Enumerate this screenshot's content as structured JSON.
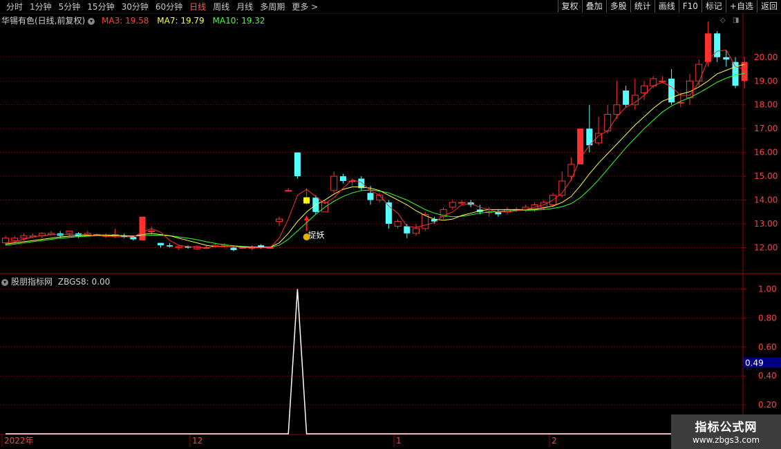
{
  "toolbar": {
    "periods": [
      "分时",
      "1分钟",
      "5分钟",
      "15分钟",
      "30分钟",
      "60分钟",
      "日线",
      "周线",
      "月线",
      "多周期",
      "更多 >"
    ],
    "active_period": "日线",
    "buttons": [
      "复权",
      "叠加",
      "多股",
      "统计",
      "画线",
      "F10",
      "标记",
      "+自选",
      "返回"
    ]
  },
  "main_chart": {
    "stock_name": "华锡有色(日线,前复权)",
    "ma3": "MA3: 19.58",
    "ma7": "MA7: 19.79",
    "ma10": "MA10: 19.32",
    "signal_label": "捉妖"
  },
  "indicator": {
    "name": "股朋指标网",
    "value_text": "ZBGS8: 0.00",
    "current_marker": "0.49"
  },
  "time_axis": [
    "2022年",
    "12",
    "1",
    "2"
  ],
  "watermark": {
    "line1": "指标公式网",
    "line2": "www.zbgs3.com"
  },
  "colors": {
    "up": "#ff3030",
    "down": "#54ffff",
    "ma3": "#ff3030",
    "ma7": "#ffff50",
    "ma10": "#30ff30",
    "grid": "#800000"
  },
  "chart_data": [
    {
      "type": "candlestick",
      "yticks": [
        12.0,
        13.0,
        14.0,
        15.0,
        16.0,
        17.0,
        18.0,
        19.0,
        20.0
      ],
      "ylim": [
        11.0,
        21.3
      ],
      "candles": [
        [
          12.2,
          12.4,
          12.5,
          12.1
        ],
        [
          12.3,
          12.4,
          12.5,
          12.2
        ],
        [
          12.4,
          12.5,
          12.6,
          12.3
        ],
        [
          12.45,
          12.5,
          12.6,
          12.4
        ],
        [
          12.5,
          12.6,
          12.65,
          12.4
        ],
        [
          12.55,
          12.6,
          12.7,
          12.5
        ],
        [
          12.6,
          12.5,
          12.7,
          12.4
        ],
        [
          12.6,
          12.7,
          12.7,
          12.5
        ],
        [
          12.6,
          12.5,
          12.65,
          12.4
        ],
        [
          12.5,
          12.6,
          12.7,
          12.5
        ],
        [
          12.55,
          12.55,
          12.6,
          12.5
        ],
        [
          12.5,
          12.5,
          12.6,
          12.4
        ],
        [
          12.5,
          12.55,
          12.8,
          12.4
        ],
        [
          12.5,
          12.45,
          12.6,
          12.4
        ],
        [
          12.45,
          12.35,
          12.5,
          12.3
        ],
        [
          12.3,
          13.3,
          13.3,
          12.3
        ],
        [
          12.7,
          12.7,
          12.9,
          12.5
        ],
        [
          12.2,
          12.1,
          12.2,
          12.0
        ],
        [
          12.1,
          12.05,
          12.2,
          12.0
        ],
        [
          12.0,
          12.05,
          12.1,
          11.9
        ],
        [
          12.05,
          12.0,
          12.1,
          11.95
        ],
        [
          11.95,
          12.05,
          12.1,
          11.9
        ],
        [
          12.0,
          12.0,
          12.1,
          11.95
        ],
        [
          12.05,
          12.1,
          12.2,
          12.0
        ],
        [
          12.05,
          12.1,
          12.2,
          12.0
        ],
        [
          12.0,
          11.9,
          12.1,
          11.85
        ],
        [
          12.0,
          12.0,
          12.05,
          11.95
        ],
        [
          12.0,
          12.0,
          12.1,
          11.9
        ],
        [
          12.1,
          12.0,
          12.15,
          11.95
        ],
        [
          12.0,
          12.0,
          12.05,
          11.95
        ],
        [
          13.1,
          13.2,
          13.3,
          12.9
        ],
        [
          14.4,
          14.4,
          14.5,
          14.4
        ],
        [
          16.0,
          15.0,
          16.0,
          14.9
        ],
        [
          14.0,
          14.0,
          14.5,
          13.8
        ],
        [
          14.1,
          13.5,
          14.2,
          13.4
        ],
        [
          13.5,
          13.9,
          14.0,
          13.5
        ],
        [
          14.4,
          15.0,
          15.2,
          14.3
        ],
        [
          15.0,
          14.8,
          15.1,
          14.7
        ],
        [
          14.8,
          14.8,
          14.9,
          14.6
        ],
        [
          14.9,
          14.5,
          15.0,
          14.4
        ],
        [
          14.3,
          14.0,
          14.6,
          13.8
        ],
        [
          14.0,
          14.2,
          14.3,
          13.9
        ],
        [
          13.9,
          13.0,
          14.0,
          12.8
        ],
        [
          12.9,
          13.1,
          13.2,
          12.8
        ],
        [
          12.9,
          12.6,
          13.0,
          12.4
        ],
        [
          12.6,
          12.8,
          13.0,
          12.5
        ],
        [
          12.8,
          13.4,
          13.5,
          12.7
        ],
        [
          13.2,
          13.1,
          13.3,
          13.0
        ],
        [
          13.3,
          13.6,
          13.7,
          13.2
        ],
        [
          13.7,
          13.9,
          14.0,
          13.6
        ],
        [
          13.9,
          13.9,
          14.0,
          13.8
        ],
        [
          13.9,
          13.8,
          14.0,
          13.7
        ],
        [
          13.6,
          13.5,
          13.8,
          13.4
        ],
        [
          13.5,
          13.5,
          13.7,
          13.3
        ],
        [
          13.5,
          13.4,
          13.6,
          13.3
        ],
        [
          13.5,
          13.6,
          13.7,
          13.4
        ],
        [
          13.6,
          13.6,
          13.7,
          13.5
        ],
        [
          13.6,
          13.7,
          13.8,
          13.5
        ],
        [
          13.6,
          13.8,
          13.9,
          13.5
        ],
        [
          13.7,
          13.9,
          14.0,
          13.6
        ],
        [
          13.8,
          14.2,
          14.3,
          13.7
        ],
        [
          14.2,
          14.8,
          15.2,
          14.1
        ],
        [
          15.0,
          15.5,
          15.8,
          14.8
        ],
        [
          15.5,
          17.0,
          17.0,
          15.5
        ],
        [
          17.0,
          16.3,
          18.0,
          16.0
        ],
        [
          16.4,
          16.8,
          17.5,
          16.3
        ],
        [
          16.9,
          17.6,
          18.0,
          16.8
        ],
        [
          17.6,
          18.0,
          19.0,
          17.4
        ],
        [
          18.6,
          18.0,
          18.8,
          17.9
        ],
        [
          18.0,
          18.4,
          19.1,
          17.8
        ],
        [
          18.5,
          18.8,
          19.0,
          18.2
        ],
        [
          18.8,
          19.1,
          19.2,
          18.7
        ],
        [
          19.0,
          19.0,
          19.2,
          18.9
        ],
        [
          19.1,
          18.1,
          19.5,
          18.0
        ],
        [
          18.1,
          18.1,
          18.5,
          17.9
        ],
        [
          18.3,
          19.0,
          19.3,
          18.0
        ],
        [
          19.0,
          19.7,
          19.9,
          18.8
        ],
        [
          19.8,
          21.0,
          21.5,
          19.6
        ],
        [
          21.0,
          20.0,
          21.1,
          19.8
        ],
        [
          20.0,
          19.9,
          20.3,
          19.6
        ],
        [
          19.8,
          18.8,
          20.0,
          18.7
        ],
        [
          19.0,
          19.8,
          20.0,
          18.7
        ]
      ],
      "ma3": [
        12.2,
        12.25,
        12.35,
        12.45,
        12.5,
        12.55,
        12.55,
        12.55,
        12.55,
        12.55,
        12.5,
        12.5,
        12.45,
        12.45,
        12.45,
        12.65,
        12.8,
        12.65,
        12.3,
        12.1,
        12.05,
        12.0,
        12.0,
        12.05,
        12.05,
        12.05,
        12.0,
        12.0,
        12.0,
        12.0,
        12.4,
        13.2,
        14.2,
        14.45,
        14.15,
        13.85,
        14.1,
        14.5,
        14.85,
        14.75,
        14.4,
        14.2,
        13.75,
        13.45,
        12.9,
        12.85,
        12.95,
        13.05,
        13.35,
        13.5,
        13.8,
        13.85,
        13.7,
        13.6,
        13.5,
        13.5,
        13.55,
        13.6,
        13.7,
        13.8,
        14.0,
        14.3,
        14.85,
        15.75,
        16.3,
        16.7,
        16.9,
        17.5,
        17.9,
        18.1,
        18.4,
        18.8,
        18.95,
        18.75,
        18.4,
        18.4,
        18.95,
        19.9,
        20.25,
        20.3,
        19.6,
        19.5
      ],
      "ma7": [
        12.15,
        12.2,
        12.25,
        12.3,
        12.35,
        12.4,
        12.45,
        12.48,
        12.5,
        12.52,
        12.53,
        12.53,
        12.52,
        12.5,
        12.48,
        12.55,
        12.6,
        12.55,
        12.5,
        12.4,
        12.3,
        12.2,
        12.1,
        12.05,
        12.05,
        12.05,
        12.03,
        12.02,
        12.02,
        12.02,
        12.2,
        12.6,
        13.1,
        13.5,
        13.8,
        14.0,
        14.25,
        14.45,
        14.55,
        14.55,
        14.5,
        14.4,
        14.2,
        14.0,
        13.8,
        13.55,
        13.35,
        13.2,
        13.15,
        13.2,
        13.35,
        13.45,
        13.55,
        13.6,
        13.6,
        13.6,
        13.6,
        13.6,
        13.62,
        13.67,
        13.75,
        13.9,
        14.15,
        14.6,
        15.1,
        15.55,
        15.95,
        16.35,
        16.75,
        17.15,
        17.5,
        17.85,
        18.15,
        18.3,
        18.45,
        18.55,
        18.75,
        19.0,
        19.3,
        19.45,
        19.6,
        19.7
      ],
      "ma10": [
        12.1,
        12.15,
        12.2,
        12.25,
        12.3,
        12.35,
        12.4,
        12.43,
        12.46,
        12.48,
        12.5,
        12.5,
        12.5,
        12.5,
        12.49,
        12.5,
        12.52,
        12.52,
        12.5,
        12.45,
        12.4,
        12.33,
        12.25,
        12.18,
        12.12,
        12.08,
        12.05,
        12.03,
        12.02,
        12.02,
        12.1,
        12.35,
        12.7,
        13.05,
        13.4,
        13.7,
        13.95,
        14.15,
        14.3,
        14.4,
        14.42,
        14.38,
        14.3,
        14.15,
        14.0,
        13.8,
        13.6,
        13.45,
        13.35,
        13.3,
        13.32,
        13.38,
        13.45,
        13.5,
        13.52,
        13.55,
        13.56,
        13.57,
        13.58,
        13.6,
        13.65,
        13.72,
        13.85,
        14.1,
        14.45,
        14.85,
        15.3,
        15.75,
        16.2,
        16.6,
        17.0,
        17.35,
        17.7,
        17.95,
        18.15,
        18.3,
        18.5,
        18.72,
        18.95,
        19.12,
        19.25,
        19.32
      ]
    },
    {
      "type": "line",
      "series": [
        {
          "name": "ZBGS8",
          "values_by_candle_index": {
            "30": 0,
            "31": 0,
            "32": 1,
            "33": 0
          }
        }
      ],
      "yticks": [
        0.2,
        0.4,
        0.6,
        0.8,
        1.0
      ],
      "ylim": [
        0.0,
        1.05
      ]
    }
  ]
}
